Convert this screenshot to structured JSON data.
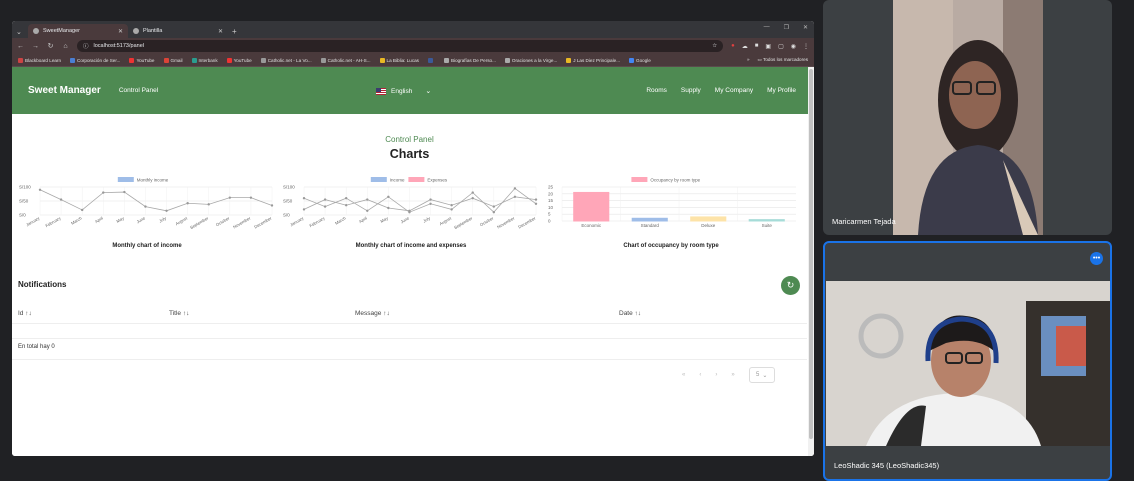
{
  "browser": {
    "tabs": [
      {
        "title": "SweetManager",
        "active": true
      },
      {
        "title": "Plantilla",
        "active": false
      }
    ],
    "new_tab": "+",
    "url": "localhost:5173/panel",
    "bookmarks": [
      "Blackboard Learn",
      "Corporación de Ser...",
      "YouTube",
      "Gmail",
      "Interbank",
      "YouTube",
      "Catholic.net - La Vo...",
      "Catholic.net - AH-S...",
      "La Biblia: Lucas",
      "",
      "Biografías De Perso...",
      "Oraciones a la Virge...",
      "J Las Diez Principale...",
      "Google"
    ],
    "bookmarks_more": "»",
    "all_bookmarks": "Todos los marcadores"
  },
  "app": {
    "brand": "Sweet Manager",
    "nav_control_panel": "Control Panel",
    "language": "English",
    "right_nav": [
      "Rooms",
      "Supply",
      "My Company",
      "My Profile"
    ],
    "subtitle": "Control Panel",
    "title": "Charts"
  },
  "charts": [
    {
      "caption": "Monthly chart of income"
    },
    {
      "caption": "Monthly chart of income and expenses"
    },
    {
      "caption": "Chart of occupancy by room type"
    }
  ],
  "chart_data": [
    {
      "type": "line",
      "legend": [
        "Monthly income"
      ],
      "categories": [
        "January",
        "February",
        "March",
        "April",
        "May",
        "June",
        "July",
        "August",
        "September",
        "October",
        "November",
        "December"
      ],
      "y_ticks": [
        "S/100",
        "S/50",
        "S/0"
      ],
      "ylim": [
        0,
        100
      ],
      "series": [
        {
          "name": "Monthly income",
          "color": "#a8a8a8",
          "values": [
            90,
            55,
            18,
            80,
            82,
            30,
            15,
            42,
            38,
            62,
            62,
            34
          ]
        }
      ]
    },
    {
      "type": "line",
      "legend": [
        "Income",
        "Expenses"
      ],
      "categories": [
        "January",
        "February",
        "March",
        "April",
        "May",
        "June",
        "July",
        "August",
        "September",
        "October",
        "November",
        "December"
      ],
      "y_ticks": [
        "S/100",
        "S/50",
        "S/0"
      ],
      "ylim": [
        0,
        100
      ],
      "series": [
        {
          "name": "Income",
          "color": "#a8a8a8",
          "values": [
            60,
            30,
            60,
            15,
            65,
            10,
            40,
            20,
            80,
            10,
            95,
            40
          ]
        },
        {
          "name": "Expenses",
          "color": "#a8a8a8",
          "values": [
            20,
            55,
            35,
            55,
            25,
            15,
            55,
            35,
            60,
            30,
            65,
            55
          ]
        }
      ]
    },
    {
      "type": "bar",
      "legend": [
        "Occupancy by room type"
      ],
      "categories": [
        "Economic",
        "Standard",
        "Deluxe",
        "Suite"
      ],
      "y_ticks": [
        "25",
        "20",
        "15",
        "10",
        "5",
        "0"
      ],
      "ylim": [
        0,
        25
      ],
      "values": [
        21,
        2,
        3,
        1
      ],
      "colors": [
        "#ffa6b8",
        "#9fbde8",
        "#fde3a8",
        "#a7dcd8"
      ]
    }
  ],
  "notifications": {
    "title": "Notifications",
    "columns": [
      "Id",
      "Title",
      "Message",
      "Date"
    ],
    "sort_glyph": "↑↓",
    "total_text": "En total hay 0",
    "pager": [
      "«",
      "‹",
      "›",
      "»"
    ],
    "page_size": "5"
  },
  "call": {
    "participants": [
      {
        "name": "Maricarmen Tejada"
      },
      {
        "name": "LeoShadic 345 (LeoShadic345)"
      }
    ],
    "more": "•••"
  },
  "colors": {
    "navbar": "#4e8a52",
    "bar_economic": "#ffa6b8",
    "bar_standard": "#9fbde8",
    "bar_deluxe": "#fde3a8",
    "bar_suite": "#a7dcd8"
  }
}
